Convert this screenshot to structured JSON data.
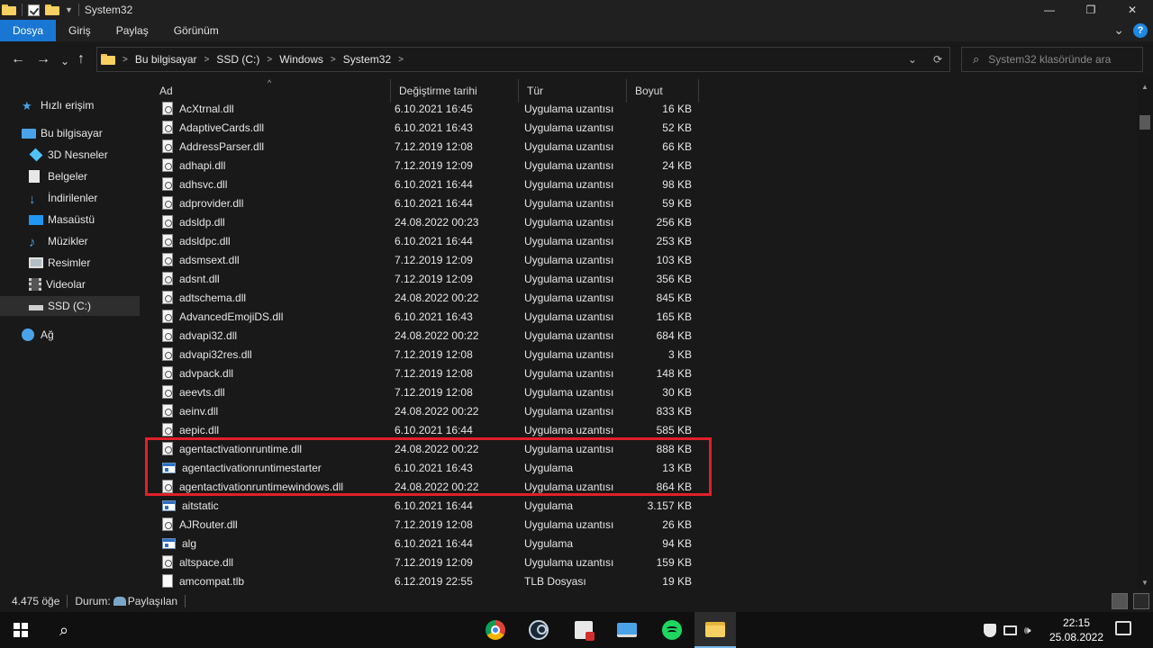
{
  "window": {
    "title": "System32",
    "minimize": "—",
    "maximize": "❐",
    "close": "✕"
  },
  "ribbon": {
    "tabs": [
      "Dosya",
      "Giriş",
      "Paylaş",
      "Görünüm"
    ],
    "expand": "⌄",
    "help": "?"
  },
  "address": {
    "back": "←",
    "forward": "→",
    "recent": "⌄",
    "up": "↑",
    "crumbs": [
      "Bu bilgisayar",
      "SSD (C:)",
      "Windows",
      "System32"
    ],
    "dropdown": "⌄",
    "refresh": "⟳"
  },
  "search": {
    "placeholder": "System32 klasöründe ara",
    "icon": "⌕"
  },
  "nav": {
    "quick_access": "Hızlı erişim",
    "this_pc": "Bu bilgisayar",
    "items": [
      "3D Nesneler",
      "Belgeler",
      "İndirilenler",
      "Masaüstü",
      "Müzikler",
      "Resimler",
      "Videolar",
      "SSD (C:)"
    ],
    "network": "Ağ"
  },
  "columns": {
    "name": "Ad",
    "date": "Değiştirme tarihi",
    "type": "Tür",
    "size": "Boyut",
    "sort_indicator": "^"
  },
  "files": [
    {
      "name": "AcXtrnal.dll",
      "date": "6.10.2021 16:45",
      "type": "Uygulama uzantısı",
      "size": "16 KB",
      "kind": "dll"
    },
    {
      "name": "AdaptiveCards.dll",
      "date": "6.10.2021 16:43",
      "type": "Uygulama uzantısı",
      "size": "52 KB",
      "kind": "dll"
    },
    {
      "name": "AddressParser.dll",
      "date": "7.12.2019 12:08",
      "type": "Uygulama uzantısı",
      "size": "66 KB",
      "kind": "dll"
    },
    {
      "name": "adhapi.dll",
      "date": "7.12.2019 12:09",
      "type": "Uygulama uzantısı",
      "size": "24 KB",
      "kind": "dll"
    },
    {
      "name": "adhsvc.dll",
      "date": "6.10.2021 16:44",
      "type": "Uygulama uzantısı",
      "size": "98 KB",
      "kind": "dll"
    },
    {
      "name": "adprovider.dll",
      "date": "6.10.2021 16:44",
      "type": "Uygulama uzantısı",
      "size": "59 KB",
      "kind": "dll"
    },
    {
      "name": "adsldp.dll",
      "date": "24.08.2022 00:23",
      "type": "Uygulama uzantısı",
      "size": "256 KB",
      "kind": "dll"
    },
    {
      "name": "adsldpc.dll",
      "date": "6.10.2021 16:44",
      "type": "Uygulama uzantısı",
      "size": "253 KB",
      "kind": "dll"
    },
    {
      "name": "adsmsext.dll",
      "date": "7.12.2019 12:09",
      "type": "Uygulama uzantısı",
      "size": "103 KB",
      "kind": "dll"
    },
    {
      "name": "adsnt.dll",
      "date": "7.12.2019 12:09",
      "type": "Uygulama uzantısı",
      "size": "356 KB",
      "kind": "dll"
    },
    {
      "name": "adtschema.dll",
      "date": "24.08.2022 00:22",
      "type": "Uygulama uzantısı",
      "size": "845 KB",
      "kind": "dll"
    },
    {
      "name": "AdvancedEmojiDS.dll",
      "date": "6.10.2021 16:43",
      "type": "Uygulama uzantısı",
      "size": "165 KB",
      "kind": "dll"
    },
    {
      "name": "advapi32.dll",
      "date": "24.08.2022 00:22",
      "type": "Uygulama uzantısı",
      "size": "684 KB",
      "kind": "dll"
    },
    {
      "name": "advapi32res.dll",
      "date": "7.12.2019 12:08",
      "type": "Uygulama uzantısı",
      "size": "3 KB",
      "kind": "dll"
    },
    {
      "name": "advpack.dll",
      "date": "7.12.2019 12:08",
      "type": "Uygulama uzantısı",
      "size": "148 KB",
      "kind": "dll"
    },
    {
      "name": "aeevts.dll",
      "date": "7.12.2019 12:08",
      "type": "Uygulama uzantısı",
      "size": "30 KB",
      "kind": "dll"
    },
    {
      "name": "aeinv.dll",
      "date": "24.08.2022 00:22",
      "type": "Uygulama uzantısı",
      "size": "833 KB",
      "kind": "dll"
    },
    {
      "name": "aepic.dll",
      "date": "6.10.2021 16:44",
      "type": "Uygulama uzantısı",
      "size": "585 KB",
      "kind": "dll"
    },
    {
      "name": "agentactivationruntime.dll",
      "date": "24.08.2022 00:22",
      "type": "Uygulama uzantısı",
      "size": "888 KB",
      "kind": "dll"
    },
    {
      "name": "agentactivationruntimestarter",
      "date": "6.10.2021 16:43",
      "type": "Uygulama",
      "size": "13 KB",
      "kind": "exe"
    },
    {
      "name": "agentactivationruntimewindows.dll",
      "date": "24.08.2022 00:22",
      "type": "Uygulama uzantısı",
      "size": "864 KB",
      "kind": "dll"
    },
    {
      "name": "aitstatic",
      "date": "6.10.2021 16:44",
      "type": "Uygulama",
      "size": "3.157 KB",
      "kind": "exe"
    },
    {
      "name": "AJRouter.dll",
      "date": "7.12.2019 12:08",
      "type": "Uygulama uzantısı",
      "size": "26 KB",
      "kind": "dll"
    },
    {
      "name": "alg",
      "date": "6.10.2021 16:44",
      "type": "Uygulama",
      "size": "94 KB",
      "kind": "exe"
    },
    {
      "name": "altspace.dll",
      "date": "7.12.2019 12:09",
      "type": "Uygulama uzantısı",
      "size": "159 KB",
      "kind": "dll"
    },
    {
      "name": "amcompat.tlb",
      "date": "6.12.2019 22:55",
      "type": "TLB Dosyası",
      "size": "19 KB",
      "kind": "tlb"
    }
  ],
  "status": {
    "count": "4.475 öğe",
    "state_label": "Durum:",
    "state_value": "Paylaşılan"
  },
  "taskbar": {
    "time": "22:15",
    "date": "25.08.2022",
    "volume": "🕪"
  },
  "colors": {
    "accent": "#1976d2",
    "highlight": "#e0202a",
    "folder": "#f7d061"
  }
}
